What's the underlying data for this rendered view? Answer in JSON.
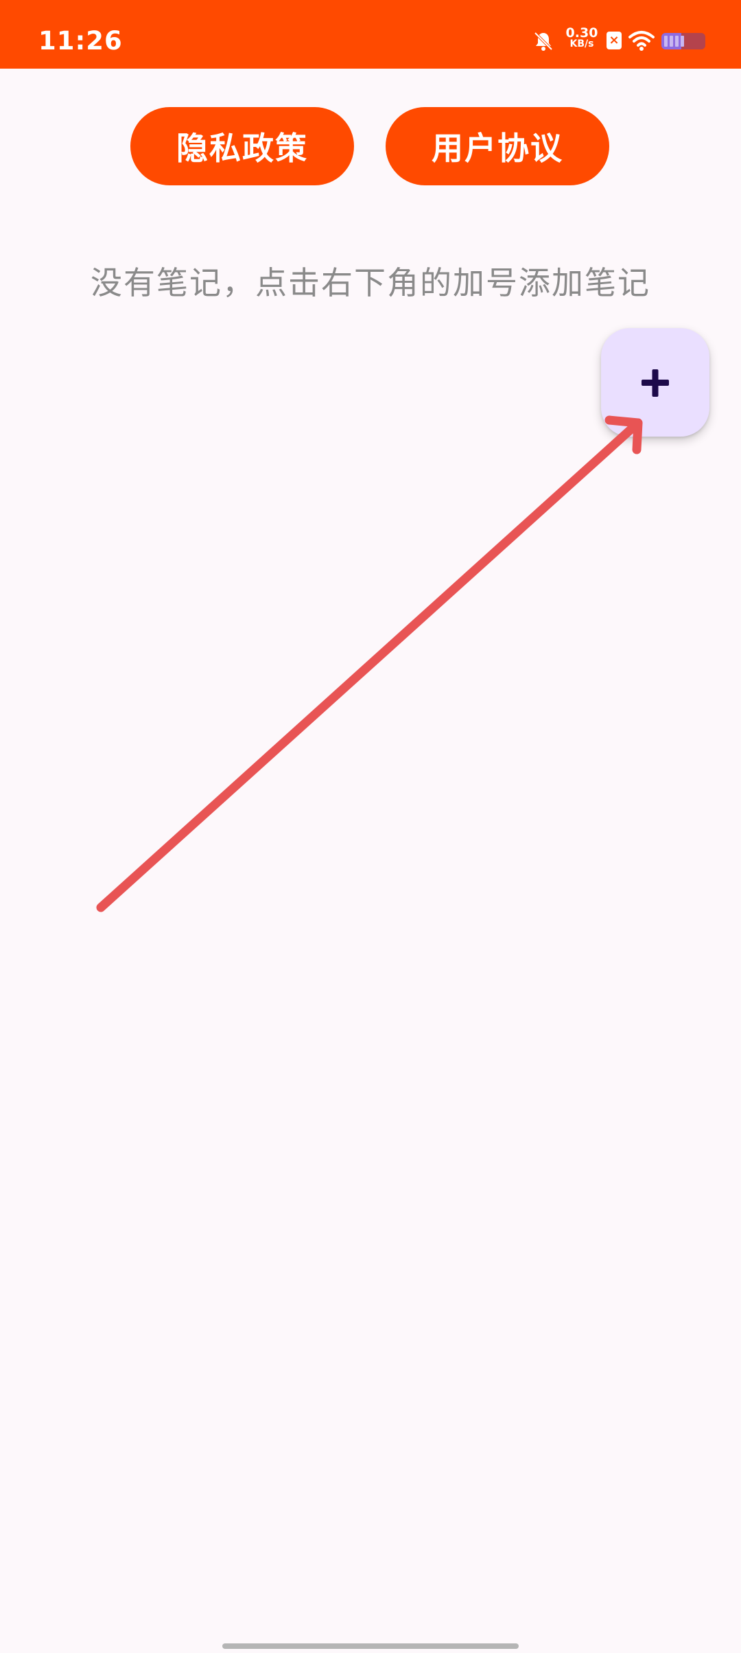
{
  "status_bar": {
    "time": "11:26",
    "net_speed_value": "0.30",
    "net_speed_unit": "KB/s",
    "sim_badge": "×",
    "icons": [
      "bell-off-icon",
      "sim-x-icon",
      "wifi-icon",
      "battery-icon"
    ],
    "battery_level": 0.45,
    "background": "#ff4a00"
  },
  "buttons": {
    "privacy_label": "隐私政策",
    "agreement_label": "用户协议",
    "color": "#ff4a00"
  },
  "empty_state": {
    "message": "没有笔记，点击右下角的加号添加笔记"
  },
  "fab": {
    "icon": "plus-icon",
    "background": "#eadfff",
    "icon_color": "#1d0a4a"
  },
  "annotation": {
    "icon": "red-arrow-icon",
    "color": "#e85454"
  }
}
